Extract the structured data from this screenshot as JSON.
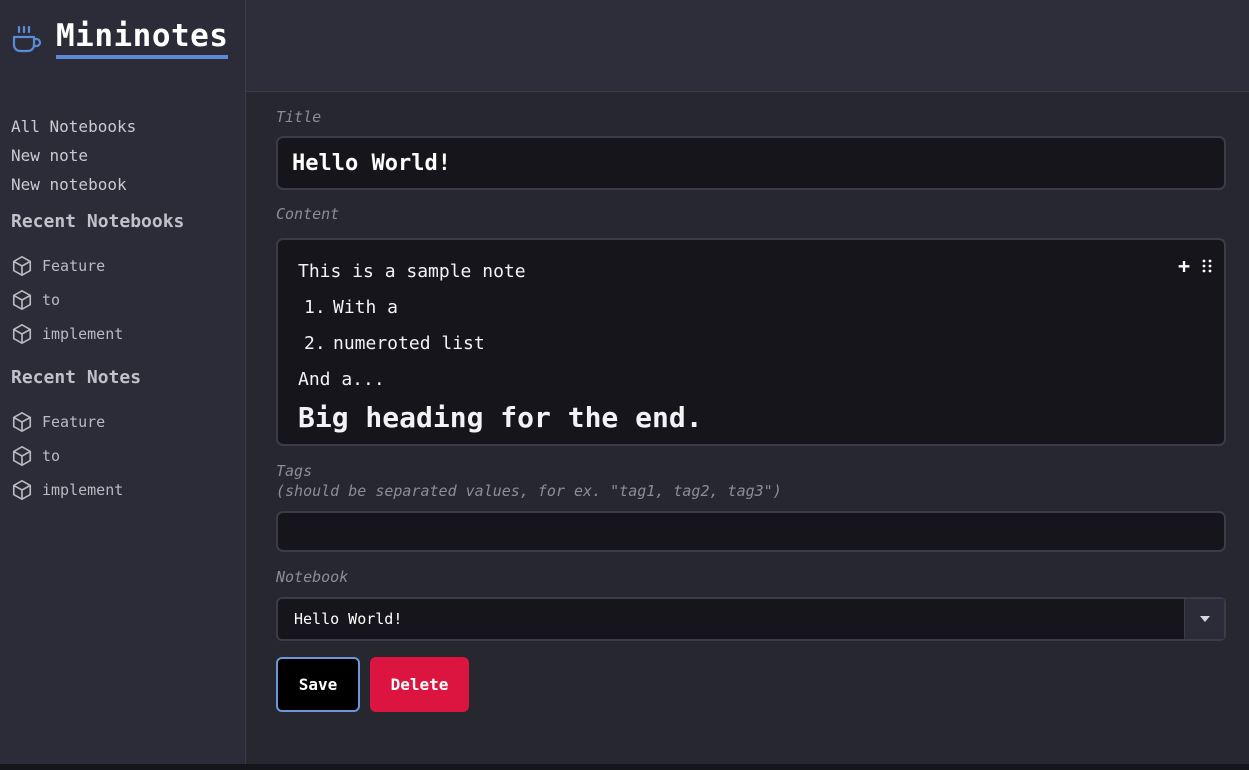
{
  "app": {
    "title": "Mininotes",
    "brand_icon": "coffee-cup-icon",
    "accent": "#5b8bd6"
  },
  "sidebar": {
    "links": [
      "All Notebooks",
      "New note",
      "New notebook"
    ],
    "recent_notebooks": {
      "title": "Recent Notebooks",
      "items": [
        {
          "label": "Feature",
          "icon": "cube-icon"
        },
        {
          "label": "to",
          "icon": "cube-icon"
        },
        {
          "label": "implement",
          "icon": "cube-icon"
        }
      ]
    },
    "recent_notes": {
      "title": "Recent Notes",
      "items": [
        {
          "label": "Feature",
          "icon": "cube-icon"
        },
        {
          "label": "to",
          "icon": "cube-icon"
        },
        {
          "label": "implement",
          "icon": "cube-icon"
        }
      ]
    }
  },
  "form": {
    "title_label": "Title",
    "title_value": "Hello World!",
    "content_label": "Content",
    "content": {
      "paragraph1": "This is a sample note",
      "list": [
        {
          "num": "1.",
          "text": "With a"
        },
        {
          "num": "2.",
          "text": "numeroted list"
        }
      ],
      "paragraph2": "And a...",
      "heading": "Big heading for the end.",
      "add_block_label": "+"
    },
    "tags_label": "Tags",
    "tags_hint": "(should be separated values, for ex. \"tag1, tag2, tag3\")",
    "tags_value": "",
    "notebook_label": "Notebook",
    "notebook_value": "Hello World!",
    "save_label": "Save",
    "delete_label": "Delete",
    "save_border_color": "#6f97d8",
    "delete_color": "#dc1540"
  }
}
